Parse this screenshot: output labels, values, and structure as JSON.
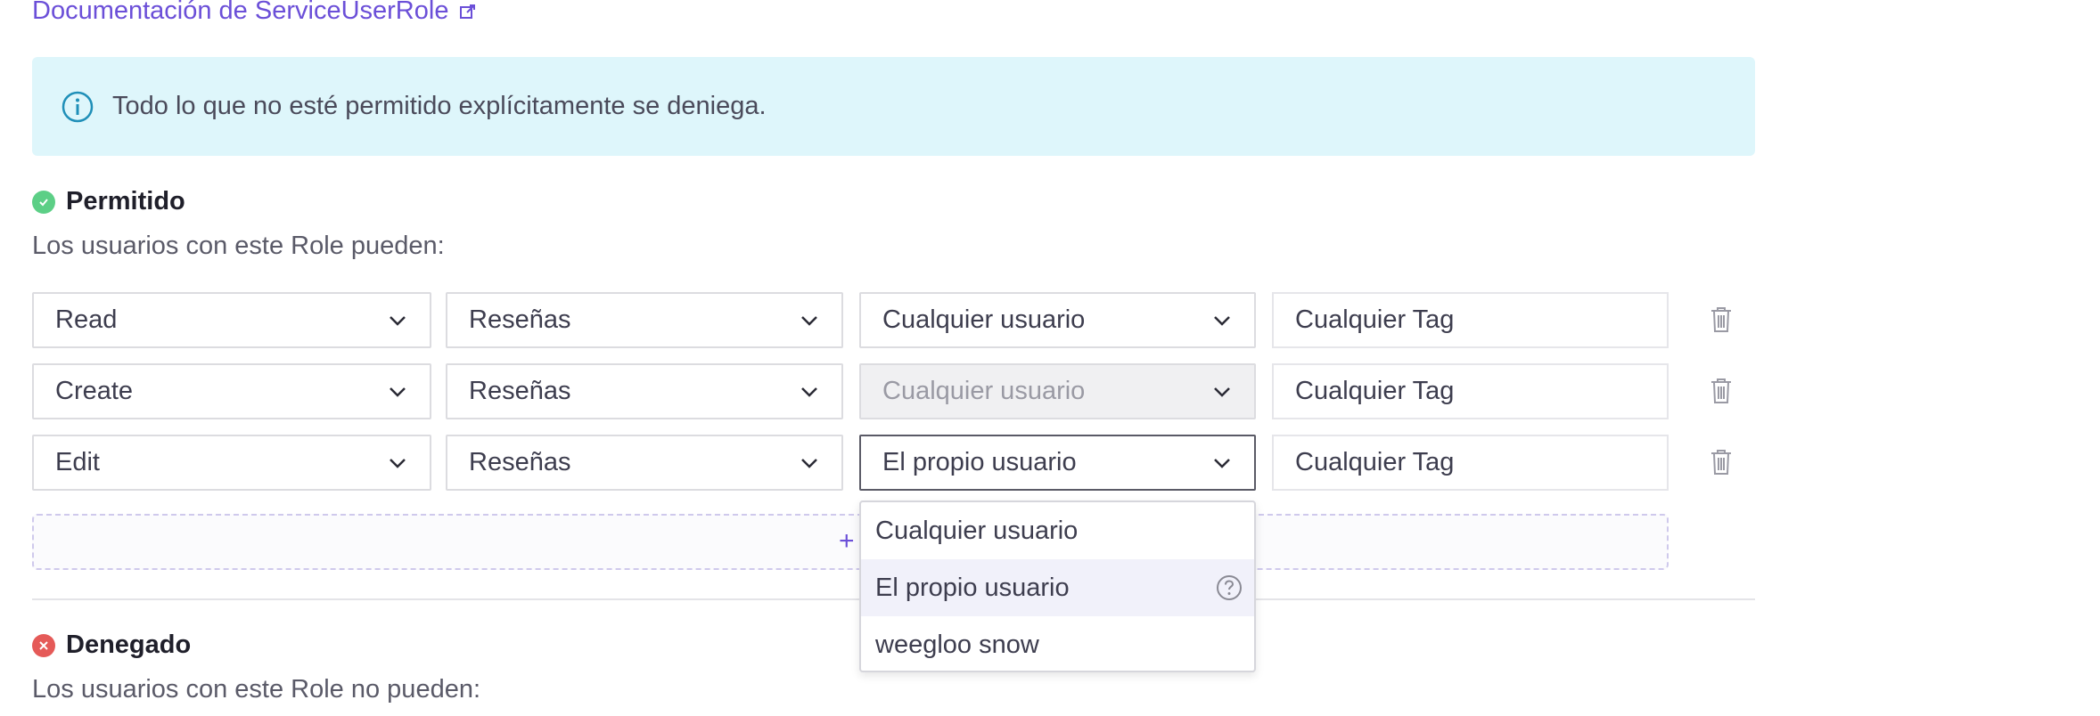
{
  "doc_link": {
    "label": "Documentación de ServiceUserRole"
  },
  "info": {
    "text": "Todo lo que no esté permitido explícitamente se deniega."
  },
  "allowed": {
    "title": "Permitido",
    "subtitle": "Los usuarios con este Role pueden:"
  },
  "rules": [
    {
      "action": "Read",
      "resource": "Reseñas",
      "scope": "Cualquier usuario",
      "tag": "Cualquier Tag",
      "scope_disabled": false
    },
    {
      "action": "Create",
      "resource": "Reseñas",
      "scope": "Cualquier usuario",
      "tag": "Cualquier Tag",
      "scope_disabled": true
    },
    {
      "action": "Edit",
      "resource": "Reseñas",
      "scope": "El propio usuario",
      "tag": "Cualquier Tag",
      "scope_disabled": false
    }
  ],
  "add_rule": {
    "symbol": "+"
  },
  "dropdown": {
    "options": [
      "Cualquier usuario",
      "El propio usuario",
      "weegloo snow"
    ],
    "selected": "El propio usuario"
  },
  "denied": {
    "title": "Denegado",
    "subtitle": "Los usuarios con este Role no pueden:"
  },
  "colors": {
    "accent": "#6b4fd8",
    "info_bg": "#def6fb",
    "info_icon": "#1f8fb8",
    "allowed": "#5ccf86",
    "denied": "#e55a58"
  },
  "icons": {
    "external_link": "external-link-icon",
    "info": "info-circle-icon",
    "allowed": "check-circle-icon",
    "denied": "x-circle-icon",
    "dropdown": "chevron-down-icon",
    "delete": "trash-icon",
    "help": "question-circle-icon"
  }
}
